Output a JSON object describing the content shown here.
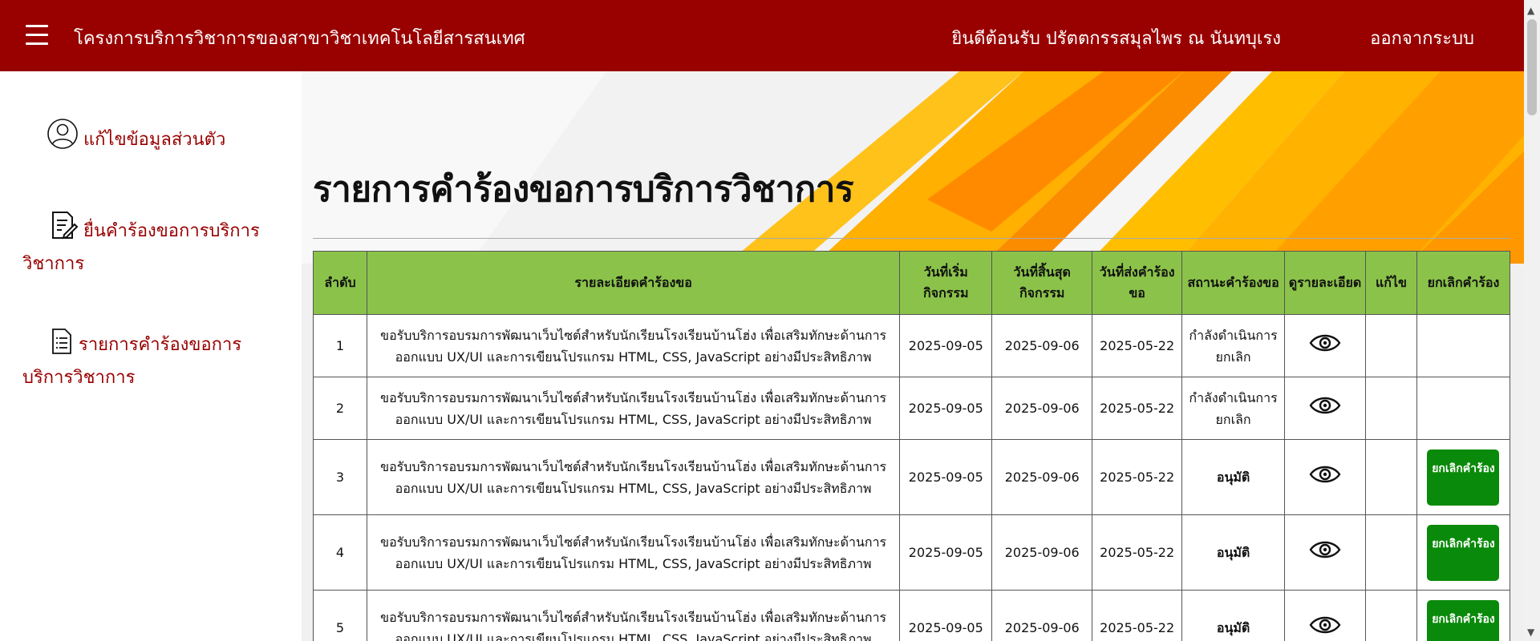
{
  "header": {
    "title": "โครงการบริการวิชาการของสาขาวิชาเทคโนโลยีสารสนเทศ",
    "welcome": "ยินดีต้อนรับ ปรัตตกรรสมุลไพร ณ นันทบุเรง",
    "logout": "ออกจากระบบ",
    "menu_icon": "hamburger-icon",
    "bg_color": "#990000"
  },
  "sidebar": {
    "items": [
      {
        "icon": "user-icon",
        "label": "แก้ไขข้อมูลส่วนตัว"
      },
      {
        "icon": "edit-document-icon",
        "label": "ยื่นคำร้องขอการบริการวิชาการ"
      },
      {
        "icon": "document-list-icon",
        "label": "รายการคำร้องขอการบริการวิชาการ"
      }
    ],
    "text_color": "#990000"
  },
  "main": {
    "page_title": "รายการคำร้องขอการบริการวิชาการ",
    "table": {
      "header_color": "#8bc34a",
      "columns": [
        "ลำดับ",
        "รายละเอียดคำร้องขอ",
        "วันที่เริ่มกิจกรรม",
        "วันที่สิ้นสุดกิจกรรม",
        "วันที่ส่งคำร้องขอ",
        "สถานะคำร้องขอ",
        "ดูรายละเอียด",
        "แก้ไข",
        "ยกเลิกคำร้อง"
      ],
      "rows": [
        {
          "no": "1",
          "detail": "ขอรับบริการอบรมการพัฒนาเว็บไซต์สำหรับนักเรียนโรงเรียนบ้านโฮ่ง เพื่อเสริมทักษะด้านการออกแบบ UX/UI และการเขียนโปรแกรม HTML, CSS, JavaScript อย่างมีประสิทธิภาพ",
          "start": "2025-09-05",
          "end": "2025-09-06",
          "sent": "2025-05-22",
          "status": "กำลังดำเนินการยกเลิก",
          "status_type": "pending",
          "can_cancel": false
        },
        {
          "no": "2",
          "detail": "ขอรับบริการอบรมการพัฒนาเว็บไซต์สำหรับนักเรียนโรงเรียนบ้านโฮ่ง เพื่อเสริมทักษะด้านการออกแบบ UX/UI และการเขียนโปรแกรม HTML, CSS, JavaScript อย่างมีประสิทธิภาพ",
          "start": "2025-09-05",
          "end": "2025-09-06",
          "sent": "2025-05-22",
          "status": "กำลังดำเนินการยกเลิก",
          "status_type": "pending",
          "can_cancel": false
        },
        {
          "no": "3",
          "detail": "ขอรับบริการอบรมการพัฒนาเว็บไซต์สำหรับนักเรียนโรงเรียนบ้านโฮ่ง เพื่อเสริมทักษะด้านการออกแบบ UX/UI และการเขียนโปรแกรม HTML, CSS, JavaScript อย่างมีประสิทธิภาพ",
          "start": "2025-09-05",
          "end": "2025-09-06",
          "sent": "2025-05-22",
          "status": "อนุมัติ",
          "status_type": "approve",
          "can_cancel": true
        },
        {
          "no": "4",
          "detail": "ขอรับบริการอบรมการพัฒนาเว็บไซต์สำหรับนักเรียนโรงเรียนบ้านโฮ่ง เพื่อเสริมทักษะด้านการออกแบบ UX/UI และการเขียนโปรแกรม HTML, CSS, JavaScript อย่างมีประสิทธิภาพ",
          "start": "2025-09-05",
          "end": "2025-09-06",
          "sent": "2025-05-22",
          "status": "อนุมัติ",
          "status_type": "approve",
          "can_cancel": true
        },
        {
          "no": "5",
          "detail": "ขอรับบริการอบรมการพัฒนาเว็บไซต์สำหรับนักเรียนโรงเรียนบ้านโฮ่ง เพื่อเสริมทักษะด้านการออกแบบ UX/UI และการเขียนโปรแกรม HTML, CSS, JavaScript อย่างมีประสิทธิภาพ",
          "start": "2025-09-05",
          "end": "2025-09-06",
          "sent": "2025-05-22",
          "status": "อนุมัติ",
          "status_type": "approve",
          "can_cancel": true
        }
      ],
      "cancel_label": "ยกเลิกคำร้อง",
      "view_icon": "eye-icon"
    }
  }
}
